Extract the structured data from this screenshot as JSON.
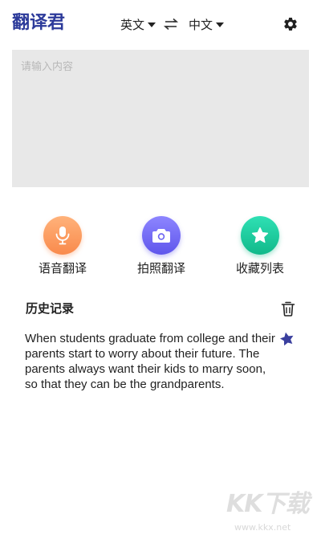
{
  "header": {
    "logo_text": "翻译君",
    "source_language": "英文",
    "target_language": "中文",
    "logo_color": "#2c3a9a"
  },
  "input": {
    "placeholder": "请输入内容",
    "value": ""
  },
  "features": [
    {
      "label": "语音翻译",
      "icon": "microphone-icon",
      "color": "#f98a4c"
    },
    {
      "label": "拍照翻译",
      "icon": "camera-icon",
      "color": "#5f56ec"
    },
    {
      "label": "收藏列表",
      "icon": "star-icon",
      "color": "#11b98a"
    }
  ],
  "history": {
    "title": "历史记录",
    "entries": [
      {
        "text": "When students graduate from college and their parents start to worry about their future. The parents always want their kids to marry soon, so that they can be the grandparents.",
        "starred": true
      }
    ]
  },
  "watermark": {
    "logo": "KK下载",
    "url": "www.kkx.net"
  }
}
